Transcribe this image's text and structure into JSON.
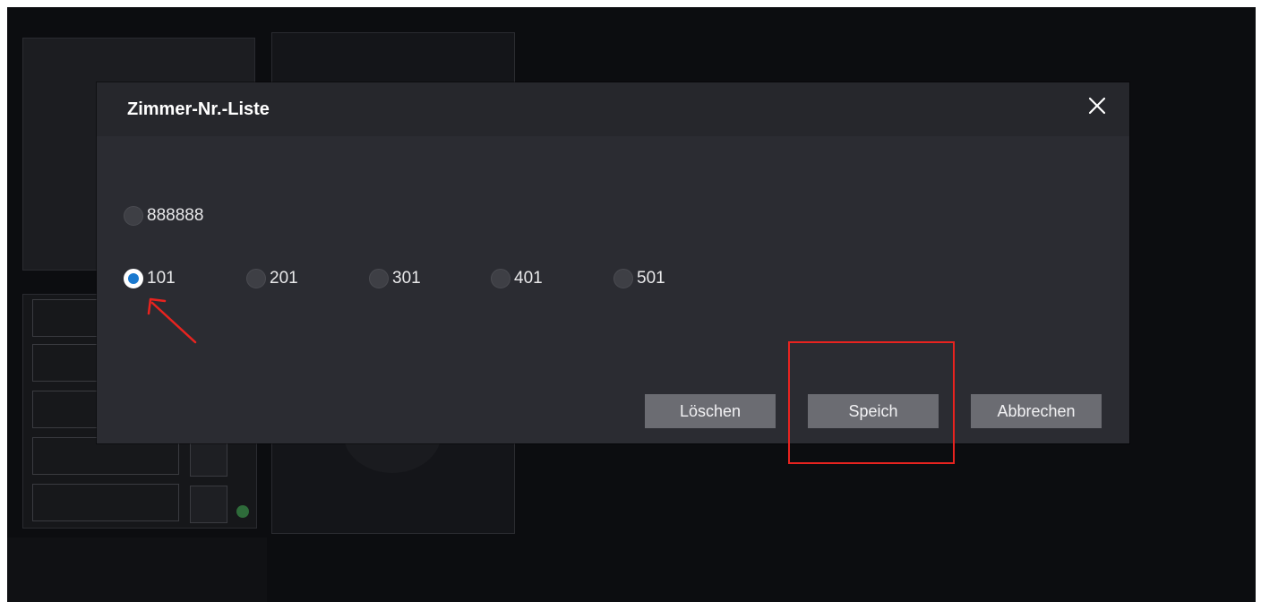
{
  "modal": {
    "title": "Zimmer-Nr.-Liste",
    "rooms_top": [
      {
        "label": "888888",
        "checked": false
      }
    ],
    "rooms_row": [
      {
        "label": "101",
        "checked": true
      },
      {
        "label": "201",
        "checked": false
      },
      {
        "label": "301",
        "checked": false
      },
      {
        "label": "401",
        "checked": false
      },
      {
        "label": "501",
        "checked": false
      }
    ],
    "buttons": {
      "delete": "Löschen",
      "save": "Speich",
      "cancel": "Abbrechen"
    }
  },
  "colors": {
    "radio_selected": "#1a79cf",
    "annotation": "#e8231f",
    "status_dot": "#2e6b3a"
  },
  "icons": {
    "close": "close-icon",
    "arrow": "annotation-arrow-icon"
  }
}
